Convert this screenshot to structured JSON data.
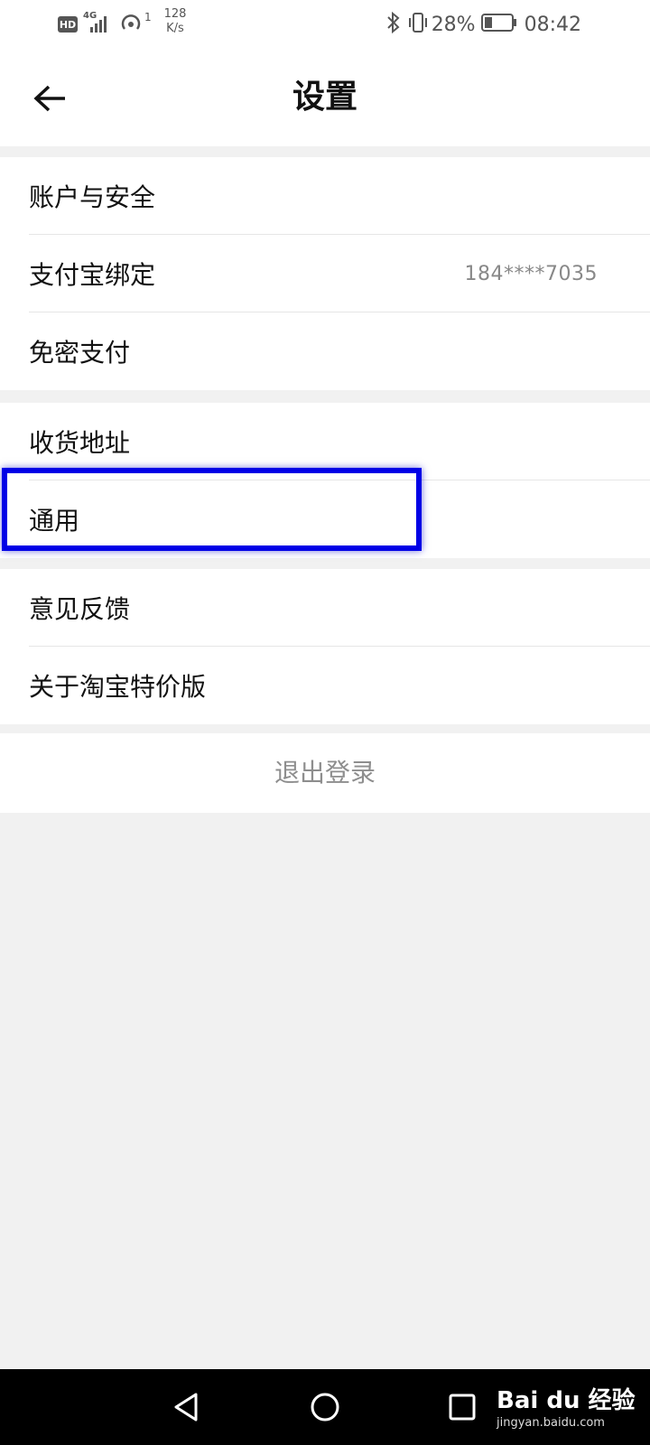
{
  "status_bar": {
    "hd_badge": "HD",
    "network_type": "4G",
    "hotspot_count": "1",
    "speed_value": "128",
    "speed_unit": "K/s",
    "battery_percent": "28%",
    "time": "08:42",
    "battery_level": 0.28
  },
  "header": {
    "title": "设置"
  },
  "group1": {
    "items": [
      {
        "label": "账户与安全",
        "value": ""
      },
      {
        "label": "支付宝绑定",
        "value": "184****7035"
      },
      {
        "label": "免密支付",
        "value": ""
      }
    ]
  },
  "group2": {
    "items": [
      {
        "label": "收货地址"
      },
      {
        "label": "通用"
      }
    ]
  },
  "group3": {
    "items": [
      {
        "label": "意见反馈"
      },
      {
        "label": "关于淘宝特价版"
      }
    ]
  },
  "logout": {
    "label": "退出登录"
  },
  "watermark": {
    "brand": "Bai du 经验",
    "site": "jingyan.baidu.com"
  },
  "colors": {
    "highlight": "#0000e6",
    "page_bg": "#f1f1f1",
    "muted_text": "#8e8e8e"
  }
}
